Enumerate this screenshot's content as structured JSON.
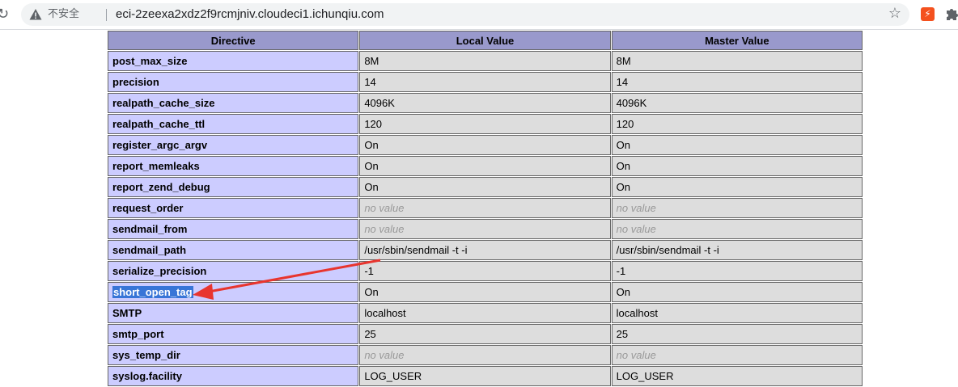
{
  "browser": {
    "security_label": "不安全",
    "url": "eci-2zeexa2xdz2f9rcmjniv.cloudeci1.ichunqiu.com",
    "extension_label": "⚡"
  },
  "table": {
    "headers": [
      "Directive",
      "Local Value",
      "Master Value"
    ],
    "rows": [
      {
        "directive": "post_max_size",
        "local": "8M",
        "master": "8M"
      },
      {
        "directive": "precision",
        "local": "14",
        "master": "14"
      },
      {
        "directive": "realpath_cache_size",
        "local": "4096K",
        "master": "4096K"
      },
      {
        "directive": "realpath_cache_ttl",
        "local": "120",
        "master": "120"
      },
      {
        "directive": "register_argc_argv",
        "local": "On",
        "master": "On"
      },
      {
        "directive": "report_memleaks",
        "local": "On",
        "master": "On"
      },
      {
        "directive": "report_zend_debug",
        "local": "On",
        "master": "On"
      },
      {
        "directive": "request_order",
        "local": "no value",
        "master": "no value"
      },
      {
        "directive": "sendmail_from",
        "local": "no value",
        "master": "no value"
      },
      {
        "directive": "sendmail_path",
        "local": "/usr/sbin/sendmail -t -i",
        "master": "/usr/sbin/sendmail -t -i"
      },
      {
        "directive": "serialize_precision",
        "local": "-1",
        "master": "-1"
      },
      {
        "directive": "short_open_tag",
        "local": "On",
        "master": "On"
      },
      {
        "directive": "SMTP",
        "local": "localhost",
        "master": "localhost"
      },
      {
        "directive": "smtp_port",
        "local": "25",
        "master": "25"
      },
      {
        "directive": "sys_temp_dir",
        "local": "no value",
        "master": "no value"
      },
      {
        "directive": "syslog.facility",
        "local": "LOG_USER",
        "master": "LOG_USER"
      }
    ]
  },
  "colors": {
    "header_bg": "#9999cc",
    "directive_bg": "#ccccff",
    "value_bg": "#dddddd",
    "no_value_text": "#999999",
    "selection": "#3875d7",
    "arrow": "#e8352e"
  }
}
